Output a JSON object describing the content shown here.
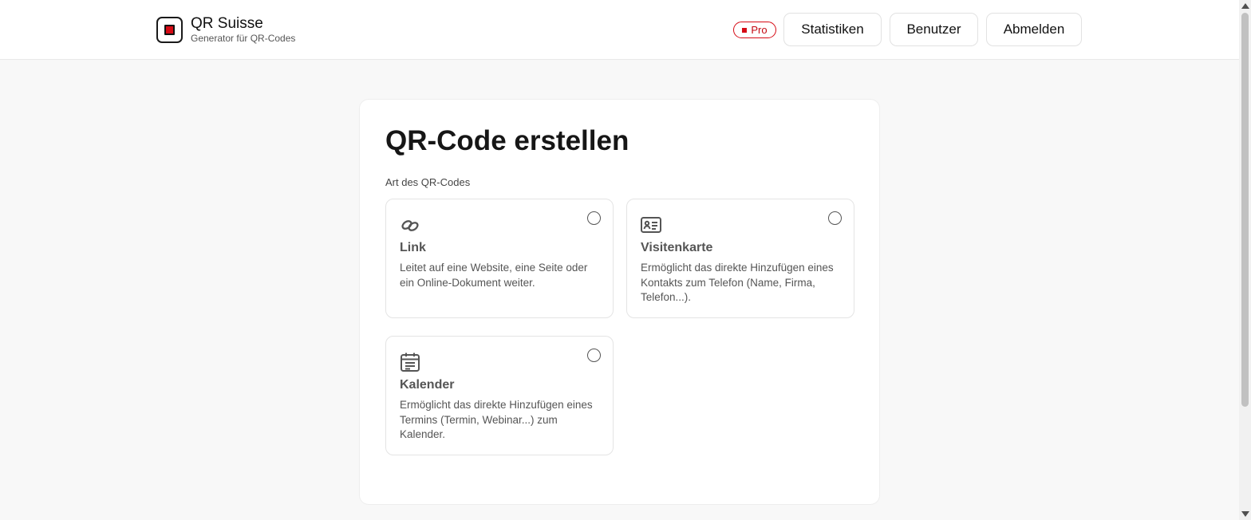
{
  "brand": {
    "title": "QR Suisse",
    "subtitle": "Generator für QR-Codes",
    "accent_color": "#d60a14"
  },
  "nav": {
    "badge": "Pro",
    "buttons": [
      {
        "label": "Statistiken"
      },
      {
        "label": "Benutzer"
      },
      {
        "label": "Abmelden"
      }
    ]
  },
  "main": {
    "title": "QR-Code erstellen",
    "section_label": "Art des QR-Codes",
    "options": [
      {
        "icon": "link-icon",
        "title": "Link",
        "description": "Leitet auf eine Website, eine Seite oder ein Online-Dokument weiter.",
        "selected": false
      },
      {
        "icon": "contact-card-icon",
        "title": "Visitenkarte",
        "description": "Ermöglicht das direkte Hinzufügen eines Kontakts zum Telefon (Name, Firma, Telefon...).",
        "selected": false
      },
      {
        "icon": "calendar-icon",
        "title": "Kalender",
        "description": "Ermöglicht das direkte Hinzufügen eines Termins (Termin, Webinar...) zum Kalender.",
        "selected": false
      }
    ]
  }
}
